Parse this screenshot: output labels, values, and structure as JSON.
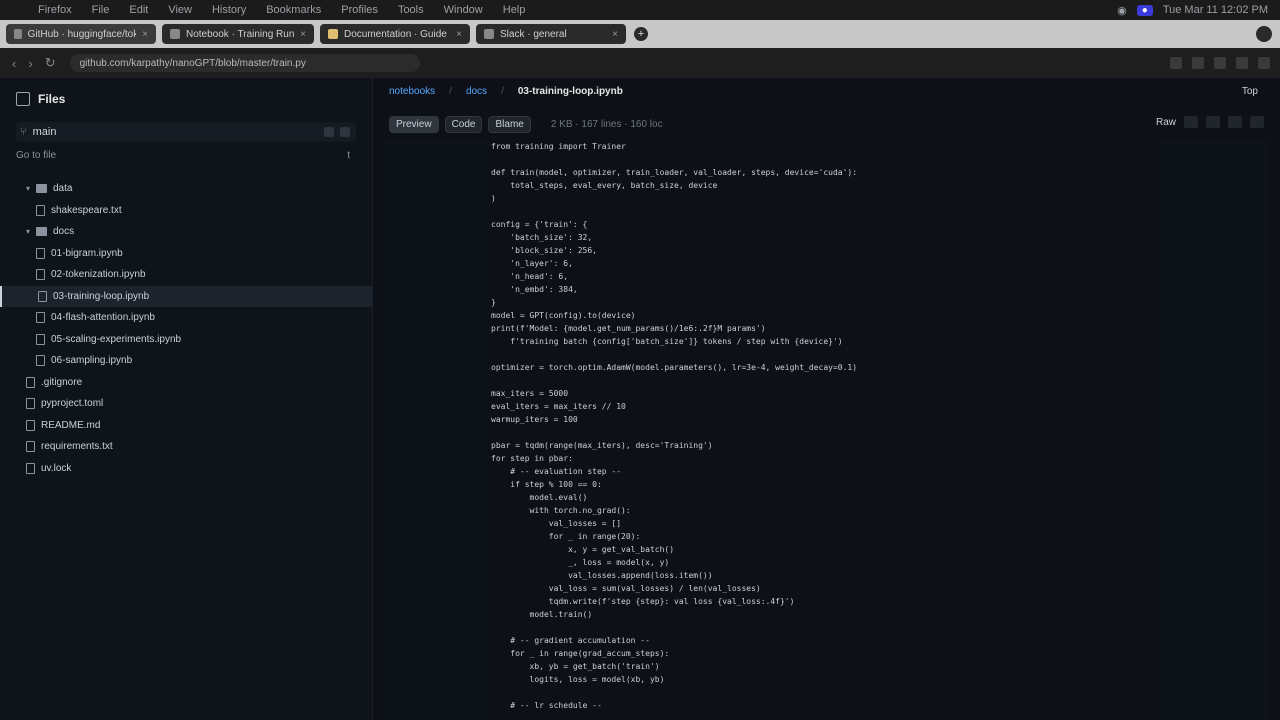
{
  "menubar": {
    "items": [
      "Firefox",
      "File",
      "Edit",
      "View",
      "History",
      "Bookmarks",
      "Profiles",
      "Tools",
      "Window",
      "Help"
    ],
    "clock": "Tue Mar 11 12:02 PM"
  },
  "browser_tabs": [
    {
      "label": "GitHub · huggingface/tokenizers"
    },
    {
      "label": "Notebook · Training Run"
    },
    {
      "label": "Documentation · Guide"
    },
    {
      "label": "Slack · general"
    }
  ],
  "address": {
    "url": "github.com/karpathy/nanoGPT/blob/master/train.py"
  },
  "sidebar": {
    "title": "Files",
    "branch": "main",
    "goto": "Go to file",
    "goto_key": "t",
    "tree": [
      {
        "type": "dir",
        "name": "data",
        "level": 0
      },
      {
        "type": "file",
        "name": "shakespeare.txt",
        "level": 1
      },
      {
        "type": "dir",
        "name": "docs",
        "level": 0
      },
      {
        "type": "file",
        "name": "01-bigram.ipynb",
        "level": 1
      },
      {
        "type": "file",
        "name": "02-tokenization.ipynb",
        "level": 1
      },
      {
        "type": "file",
        "name": "03-training-loop.ipynb",
        "level": 1,
        "selected": true
      },
      {
        "type": "file",
        "name": "04-flash-attention.ipynb",
        "level": 1
      },
      {
        "type": "file",
        "name": "05-scaling-experiments.ipynb",
        "level": 1
      },
      {
        "type": "file",
        "name": "06-sampling.ipynb",
        "level": 1
      },
      {
        "type": "file",
        "name": ".gitignore",
        "level": 0
      },
      {
        "type": "file",
        "name": "pyproject.toml",
        "level": 0
      },
      {
        "type": "file",
        "name": "README.md",
        "level": 0
      },
      {
        "type": "file",
        "name": "requirements.txt",
        "level": 0
      },
      {
        "type": "file",
        "name": "uv.lock",
        "level": 0
      }
    ]
  },
  "main": {
    "breadcrumbs": [
      "notebooks",
      "docs",
      "03-training-loop.ipynb"
    ],
    "top_right": "Top",
    "toolbar": [
      "Preview",
      "Code",
      "Blame"
    ],
    "meta": "2 KB · 167 lines · 160 loc",
    "right_label": "Raw"
  },
  "code_lines": [
    "from training import Trainer",
    "",
    "def train(model, optimizer, train_loader, val_loader, steps, device='cuda'):",
    "    total_steps, eval_every, batch_size, device",
    ")",
    "",
    "config = {'train': {",
    "    'batch_size': 32,",
    "    'block_size': 256,",
    "    'n_layer': 6,",
    "    'n_head': 6,",
    "    'n_embd': 384,",
    "}",
    "model = GPT(config).to(device)",
    "print(f'Model: {model.get_num_params()/1e6:.2f}M params')",
    "    f'training batch {config['batch_size']} tokens / step with {device}')",
    "",
    "optimizer = torch.optim.AdamW(model.parameters(), lr=3e-4, weight_decay=0.1)",
    "",
    "max_iters = 5000",
    "eval_iters = max_iters // 10",
    "warmup_iters = 100",
    "",
    "pbar = tqdm(range(max_iters), desc='Training')",
    "for step in pbar:",
    "    # -- evaluation step --",
    "    if step % 100 == 0:",
    "        model.eval()",
    "        with torch.no_grad():",
    "            val_losses = []",
    "            for _ in range(20):",
    "                x, y = get_val_batch()",
    "                _, loss = model(x, y)",
    "                val_losses.append(loss.item())",
    "            val_loss = sum(val_losses) / len(val_losses)",
    "            tqdm.write(f'step {step}: val loss {val_loss:.4f}')",
    "        model.train()",
    "",
    "    # -- gradient accumulation --",
    "    for _ in range(grad_accum_steps):",
    "        xb, yb = get_batch('train')",
    "        logits, loss = model(xb, yb)",
    "",
    "    # -- lr schedule --"
  ]
}
